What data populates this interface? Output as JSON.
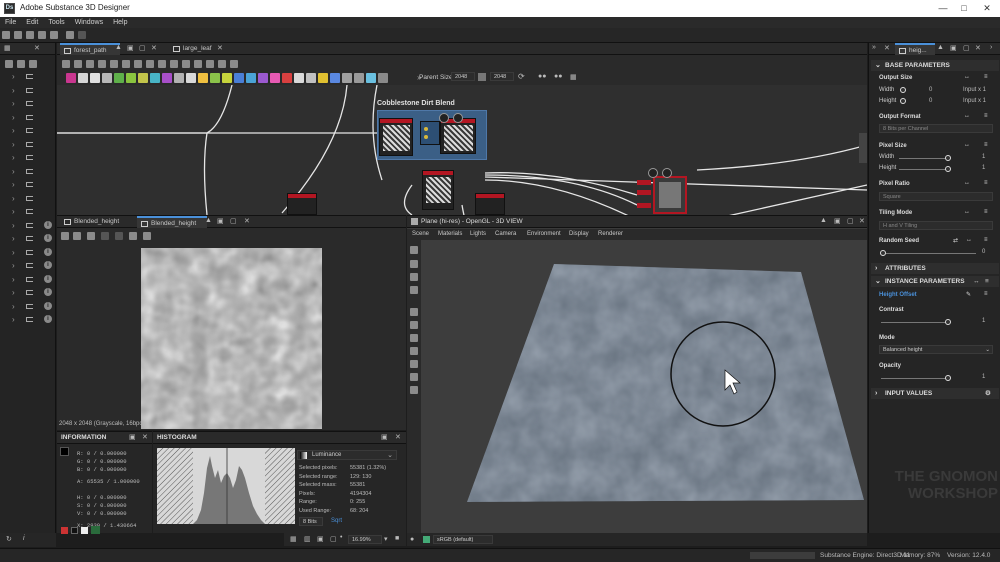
{
  "window": {
    "title": "Adobe Substance 3D Designer",
    "app_icon": "Ds"
  },
  "menu": [
    "File",
    "Edit",
    "Tools",
    "Windows",
    "Help"
  ],
  "graph": {
    "tabs": [
      "forest_path",
      "large_leaf"
    ],
    "parent_size_label": "Parent Size:",
    "parent_size_value": "2048",
    "size_value2": "2048",
    "frame_title": "Cobblestone Dirt Blend"
  },
  "viewer2d": {
    "tabs": [
      "Blended_height",
      "Blended_height"
    ],
    "status": "2048 x 2048 (Grayscale, 16bpc)"
  },
  "viewer3d": {
    "title": "Plane (hi-res) - OpenGL - 3D VIEW",
    "menu": [
      "Scene",
      "Materials",
      "Lights",
      "Camera",
      "Environment",
      "Display",
      "Renderer"
    ],
    "colorspace": "sRGB (default)"
  },
  "information": {
    "title": "INFORMATION",
    "rows": [
      {
        "label": "R:",
        "value": "0 / 0.000000"
      },
      {
        "label": "G:",
        "value": "0 / 0.000000"
      },
      {
        "label": "B:",
        "value": "0 / 0.000000"
      },
      {
        "label": "A:",
        "value": "65535 / 1.000000"
      },
      {
        "label": "H:",
        "value": "0 / 0.000000"
      },
      {
        "label": "S:",
        "value": "0 / 0.000000"
      },
      {
        "label": "V:",
        "value": "0 / 0.000000"
      },
      {
        "label": "X:",
        "value": "2930 / 1.430664"
      }
    ]
  },
  "histogram": {
    "title": "HISTOGRAM",
    "channel": "Luminance",
    "stats": [
      {
        "label": "Selected pixels:",
        "value": "55381 (1.32%)"
      },
      {
        "label": "Selected range:",
        "value": "129: 130"
      },
      {
        "label": "Selected mass:",
        "value": "55381"
      },
      {
        "label": "Pixels:",
        "value": "4194304"
      },
      {
        "label": "Range:",
        "value": "0: 255"
      },
      {
        "label": "Used Range:",
        "value": "68: 204"
      }
    ],
    "bits": "8 Bits",
    "sqrt": "Sqrt",
    "zoom": "16.99%"
  },
  "properties": {
    "tab": "heig...",
    "base_parameters": "BASE PARAMETERS",
    "output_size": "Output Size",
    "width_label": "Width",
    "height_label": "Height",
    "width_value": "0",
    "height_value": "0",
    "width_input": "Input x 1",
    "height_input": "Input x 1",
    "output_format": "Output Format",
    "output_format_value": "8 Bits per Channel",
    "pixel_size": "Pixel Size",
    "px_width_value": "1",
    "px_height_value": "1",
    "pixel_ratio": "Pixel Ratio",
    "pixel_ratio_value": "Square",
    "tiling_mode": "Tiling Mode",
    "tiling_mode_value": "H and V Tiling",
    "random_seed": "Random Seed",
    "random_seed_value": "0",
    "attributes": "ATTRIBUTES",
    "instance_parameters": "INSTANCE PARAMETERS",
    "height_offset": "Height Offset",
    "contrast": "Contrast",
    "contrast_value": "1",
    "mode": "Mode",
    "mode_value": "Balanced height",
    "opacity": "Opacity",
    "opacity_value": "1",
    "input_values": "INPUT VALUES"
  },
  "status": {
    "engine": "Substance Engine: Direct3D 11",
    "memory": "Memory: 87%",
    "version": "Version: 12.4.0"
  },
  "watermark": {
    "line1": "THE GNOMON",
    "line2": "WORKSHOP"
  }
}
